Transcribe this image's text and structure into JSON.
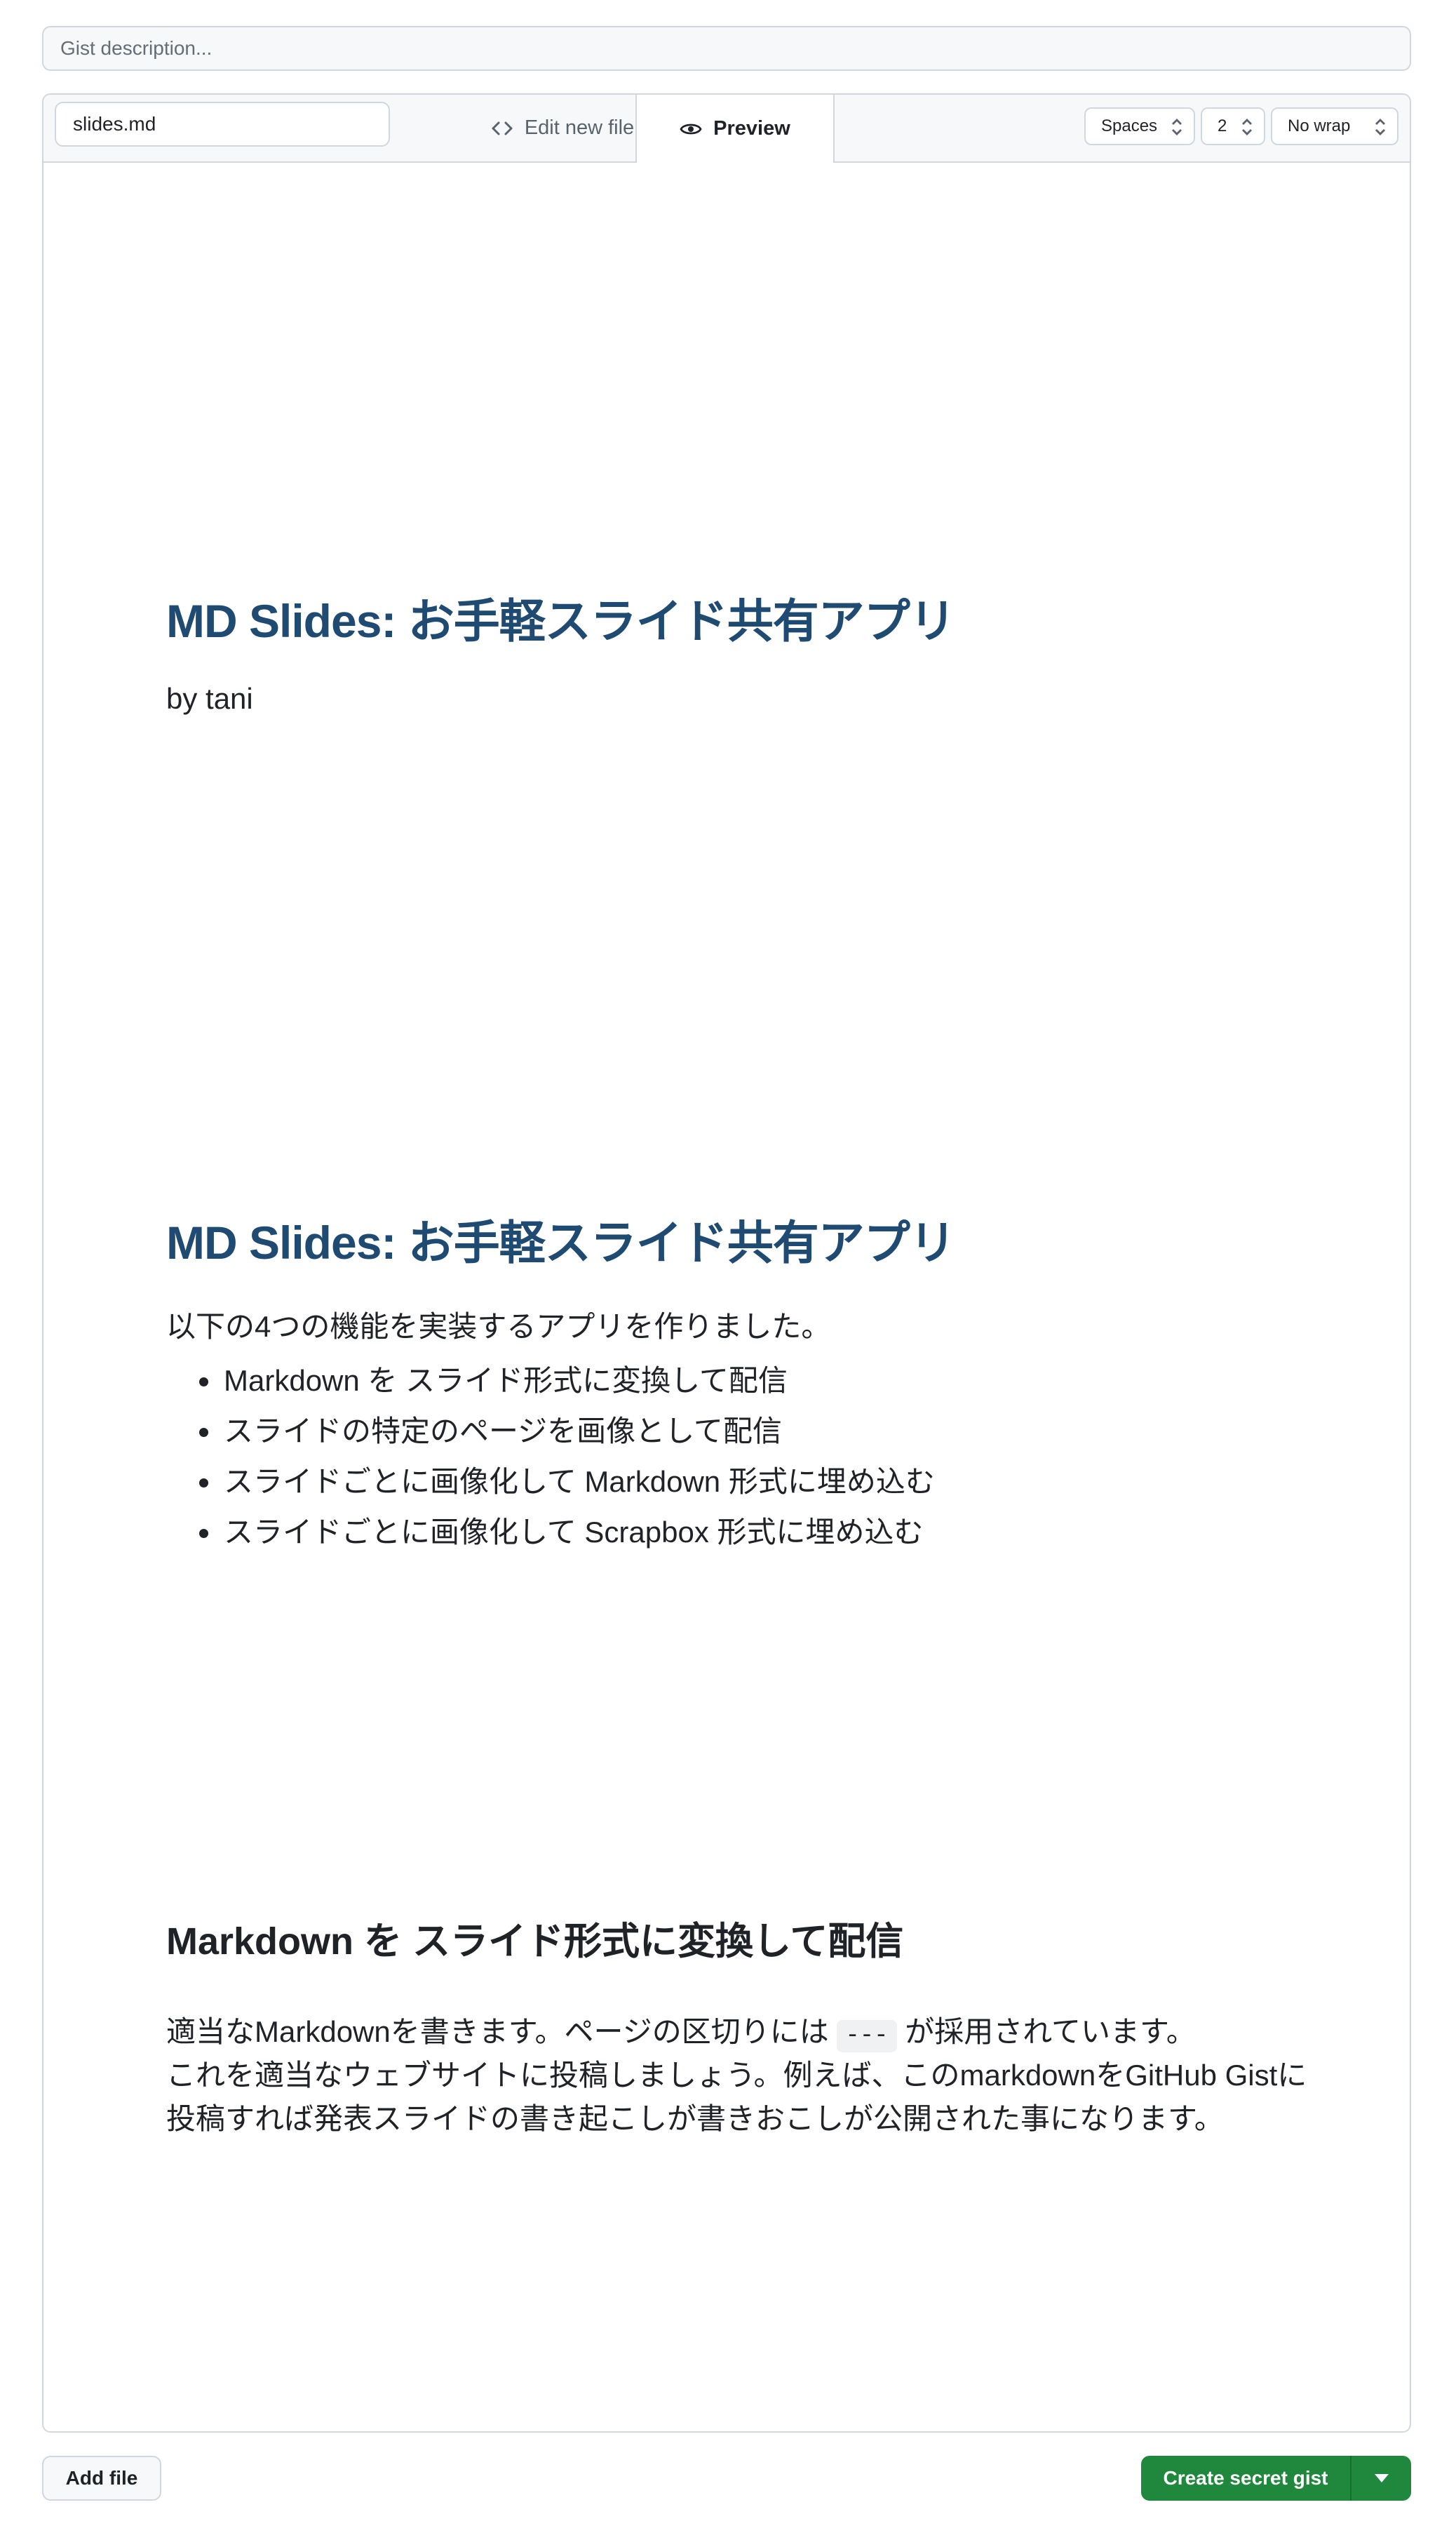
{
  "gist": {
    "description_placeholder": "Gist description...",
    "filename_value": "slides.md"
  },
  "tabs": {
    "edit_label": "Edit new file",
    "preview_label": "Preview"
  },
  "editor_settings": {
    "indent_mode": "Spaces",
    "indent_size": "2",
    "wrap_mode": "No wrap"
  },
  "preview": {
    "slide1": {
      "title": "MD Slides: お手軽スライド共有アプリ",
      "byline": "by tani"
    },
    "slide2": {
      "title": "MD Slides: お手軽スライド共有アプリ",
      "intro": "以下の4つの機能を実装するアプリを作りました。",
      "features": [
        "Markdown を スライド形式に変換して配信",
        "スライドの特定のページを画像として配信",
        "スライドごとに画像化して Markdown 形式に埋め込む",
        "スライドごとに画像化して Scrapbox 形式に埋め込む"
      ]
    },
    "slide3": {
      "title": "Markdown を スライド形式に変換して配信",
      "line1_before": "適当なMarkdownを書きます。ページの区切りには",
      "line1_code": "---",
      "line1_after": "が採用されています。",
      "line2": "これを適当なウェブサイトに投稿しましょう。例えば、このmarkdownをGitHub Gistに",
      "line3": "投稿すれば発表スライドの書き起こしが書きおこしが公開された事になります。"
    }
  },
  "actions": {
    "add_file_label": "Add file",
    "create_label": "Create secret gist"
  },
  "colors": {
    "primary_button": "#1f883d",
    "slide_title": "#1f4b73",
    "border": "#d0d7de"
  }
}
